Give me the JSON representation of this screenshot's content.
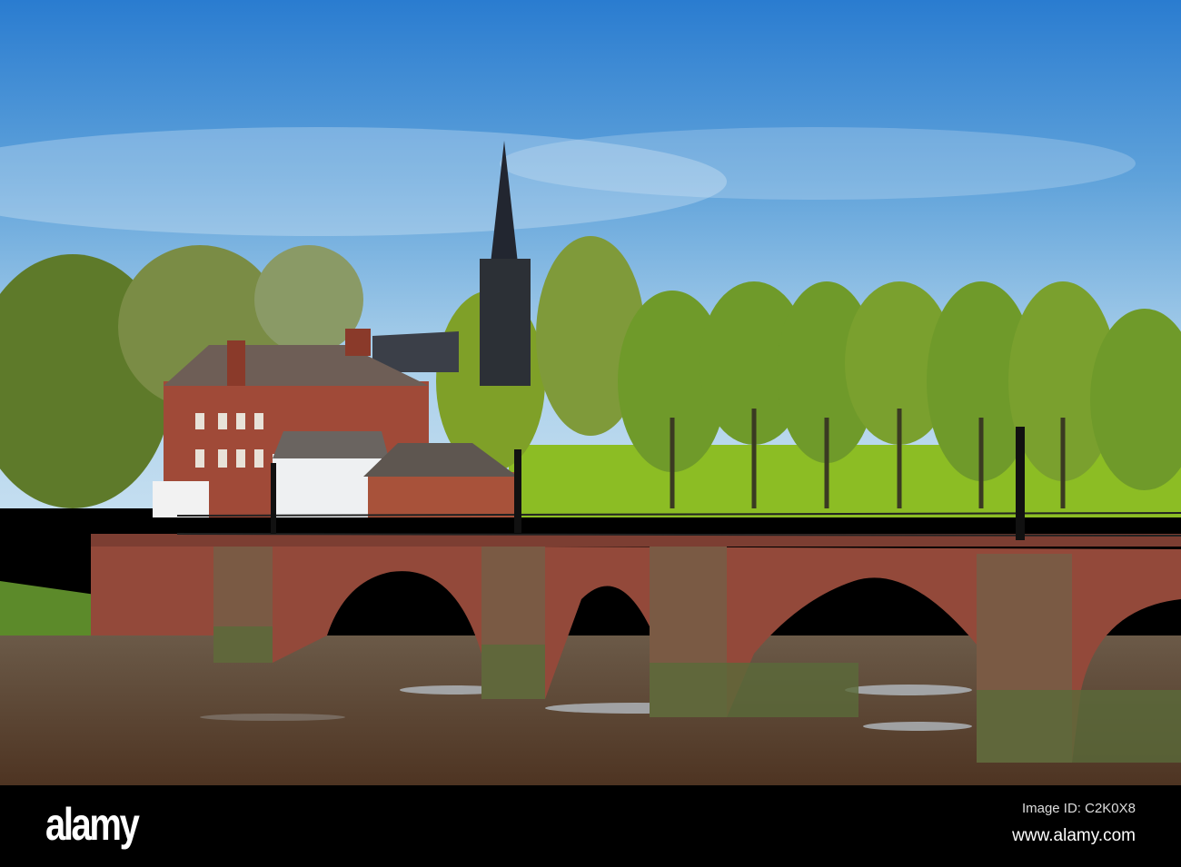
{
  "photo": {
    "subject": "Stone bridge over river with church spire and trees"
  },
  "footer": {
    "logo": "alamy",
    "image_id": "Image ID: C2K0X8",
    "website": "www.alamy.com"
  },
  "colors": {
    "sky_top": "#2a7cd0",
    "sky_low": "#b4d6ec",
    "foliage": "#6f9a2a",
    "sandstone": "#93493a",
    "river": "#5e4430"
  }
}
